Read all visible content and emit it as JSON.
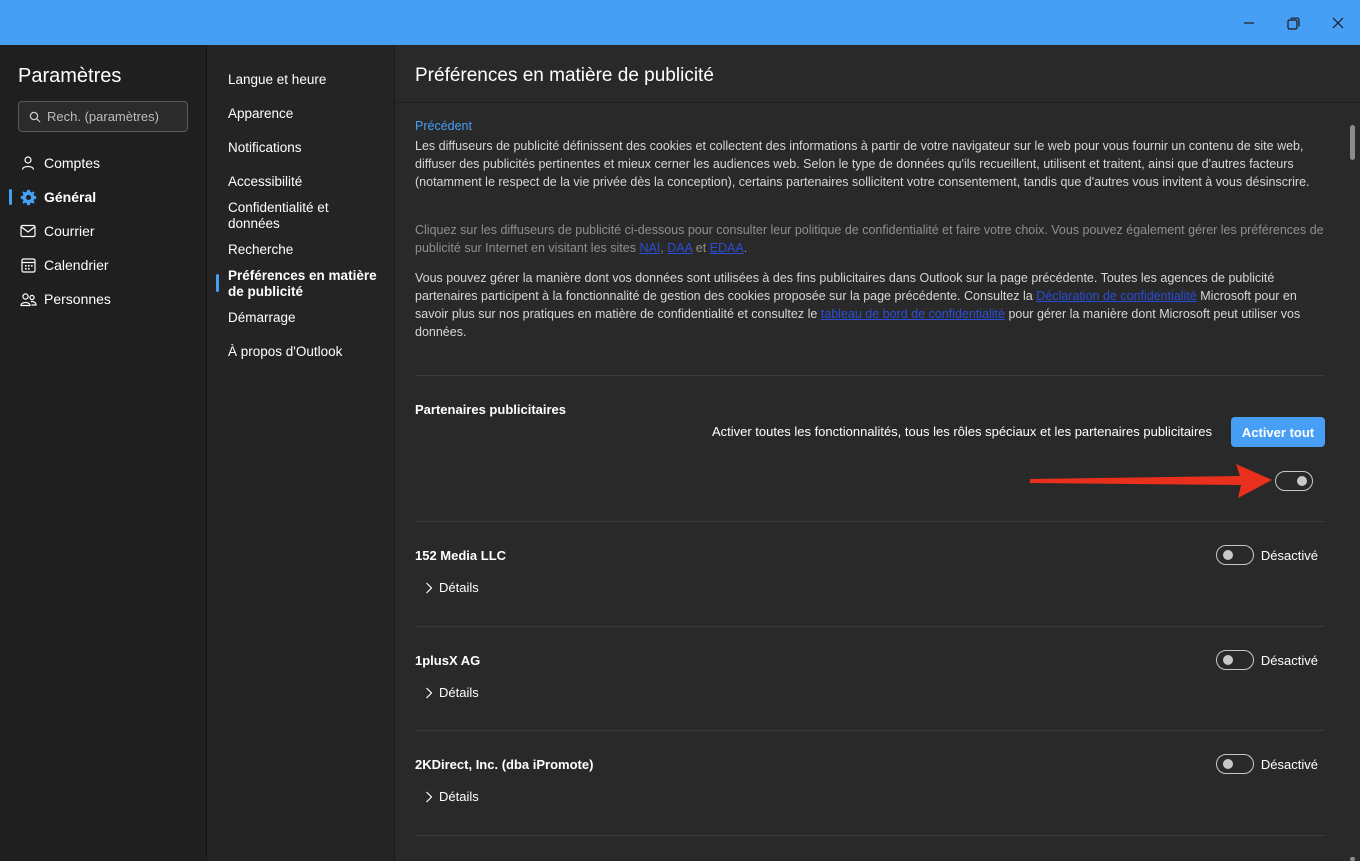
{
  "window": {
    "minimize_label": "—",
    "restore_label": "❐",
    "close_label": "✕"
  },
  "sidebar": {
    "title": "Paramètres",
    "search_placeholder": "Rech. (paramètres)",
    "items": [
      {
        "label": "Comptes",
        "icon": "person-icon"
      },
      {
        "label": "Général",
        "icon": "gear-icon",
        "active": true
      },
      {
        "label": "Courrier",
        "icon": "mail-icon"
      },
      {
        "label": "Calendrier",
        "icon": "calendar-icon"
      },
      {
        "label": "Personnes",
        "icon": "people-icon"
      }
    ]
  },
  "subnav": {
    "items": [
      {
        "label": "Langue et heure"
      },
      {
        "label": "Apparence"
      },
      {
        "label": "Notifications"
      },
      {
        "label": "Accessibilité"
      },
      {
        "label": "Confidentialité et données"
      },
      {
        "label": "Recherche"
      },
      {
        "label": "Préférences en matière de publicité",
        "active": true
      },
      {
        "label": "Démarrage"
      },
      {
        "label": "À propos d'Outlook"
      }
    ]
  },
  "content": {
    "title": "Préférences en matière de publicité",
    "back_link": "Précédent",
    "para1": "Les diffuseurs de publicité définissent des cookies et collectent des informations à partir de votre navigateur sur le web pour vous fournir un contenu de site web, diffuser des publicités pertinentes et mieux cerner les audiences web. Selon le type de données qu'ils recueillent, utilisent et traitent, ainsi que d'autres facteurs (notamment le respect de la vie privée dès la conception), certains partenaires sollicitent votre consentement, tandis que d'autres vous invitent à vous désinscrire.",
    "para2": {
      "text": "Cliquez sur les diffuseurs de publicité ci-dessous pour consulter leur politique de confidentialité et faire votre choix. Vous pouvez également gérer les préférences de publicité sur Internet en visitant les sites",
      "link1": "NAI",
      "sep1": ",",
      "link2": "DAA",
      "sep2": "et",
      "link3": "EDAA",
      "end": "."
    },
    "para3": {
      "text1": "Vous pouvez gérer la manière dont vos données sont utilisées à des fins publicitaires dans Outlook sur la page précédente. Toutes les agences de publicité partenaires participent à la fonctionnalité de gestion des cookies proposée sur la page précédente. Consultez la",
      "link1": "Déclaration de confidentialité",
      "text2": "Microsoft pour en savoir plus sur nos pratiques en matière de confidentialité et consultez le",
      "link2": "tableau de bord de confidentialité",
      "text3": "pour gérer la manière dont Microsoft peut utiliser vos données."
    },
    "partners_section": {
      "title": "Partenaires publicitaires",
      "enable_all_text": "Activer toutes les fonctionnalités, tous les rôles spéciaux et les partenaires publicitaires",
      "enable_all_button": "Activer tout",
      "master_toggle_on": false
    },
    "partners": [
      {
        "name": "152 Media LLC",
        "state": "Désactivé",
        "details": "Détails"
      },
      {
        "name": "1plusX AG",
        "state": "Désactivé",
        "details": "Détails"
      },
      {
        "name": "2KDirect, Inc. (dba iPromote)",
        "state": "Désactivé",
        "details": "Détails"
      }
    ]
  },
  "colors": {
    "accent": "#479ef5",
    "annotation_arrow": "#e8301c"
  }
}
